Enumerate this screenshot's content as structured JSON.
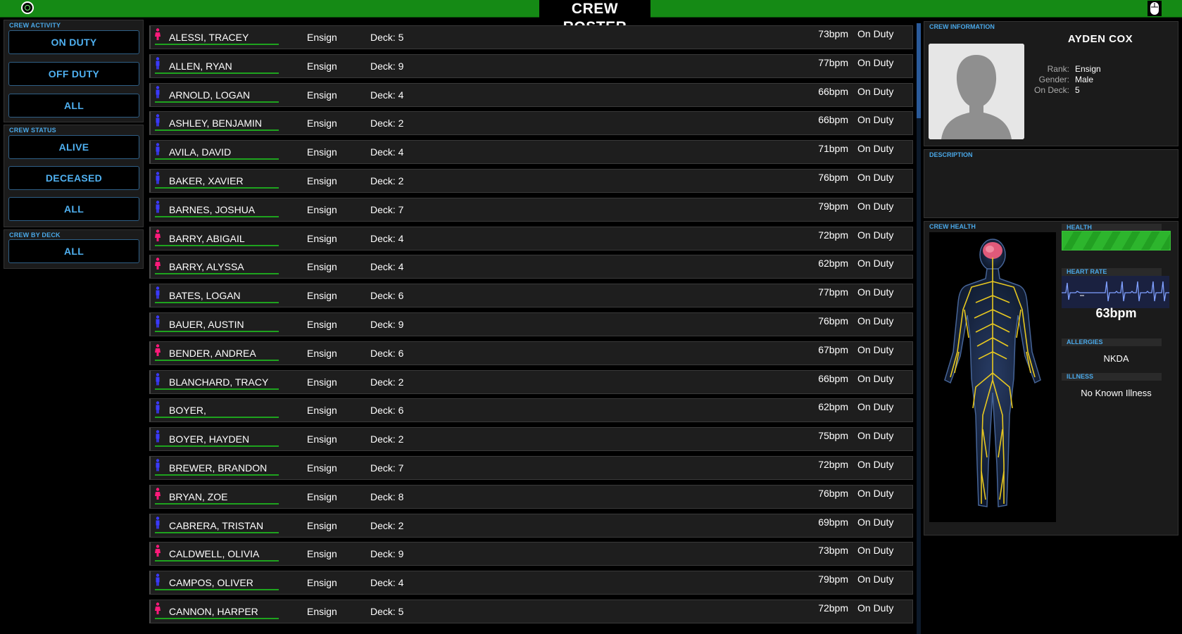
{
  "header": {
    "title": "CREW ROSTER"
  },
  "filters": {
    "activity": {
      "title": "CREW ACTIVITY",
      "buttons": [
        "ON DUTY",
        "OFF DUTY",
        "ALL"
      ]
    },
    "status": {
      "title": "CREW STATUS",
      "buttons": [
        "ALIVE",
        "DECEASED",
        "ALL"
      ]
    },
    "deck": {
      "title": "CREW BY DECK",
      "buttons": [
        "ALL"
      ]
    }
  },
  "roster": [
    {
      "name": "ALESSI, TRACEY",
      "gender": "female",
      "rank": "Ensign",
      "deck": "Deck: 5",
      "bpm": "73bpm",
      "status": "On Duty"
    },
    {
      "name": "ALLEN, RYAN",
      "gender": "male",
      "rank": "Ensign",
      "deck": "Deck: 9",
      "bpm": "77bpm",
      "status": "On Duty"
    },
    {
      "name": "ARNOLD, LOGAN",
      "gender": "male",
      "rank": "Ensign",
      "deck": "Deck: 4",
      "bpm": "66bpm",
      "status": "On Duty"
    },
    {
      "name": "ASHLEY, BENJAMIN",
      "gender": "male",
      "rank": "Ensign",
      "deck": "Deck: 2",
      "bpm": "66bpm",
      "status": "On Duty"
    },
    {
      "name": "AVILA, DAVID",
      "gender": "male",
      "rank": "Ensign",
      "deck": "Deck: 4",
      "bpm": "71bpm",
      "status": "On Duty"
    },
    {
      "name": "BAKER, XAVIER",
      "gender": "male",
      "rank": "Ensign",
      "deck": "Deck: 2",
      "bpm": "76bpm",
      "status": "On Duty"
    },
    {
      "name": "BARNES, JOSHUA",
      "gender": "male",
      "rank": "Ensign",
      "deck": "Deck: 7",
      "bpm": "79bpm",
      "status": "On Duty"
    },
    {
      "name": "BARRY, ABIGAIL",
      "gender": "female",
      "rank": "Ensign",
      "deck": "Deck: 4",
      "bpm": "72bpm",
      "status": "On Duty"
    },
    {
      "name": "BARRY, ALYSSA",
      "gender": "female",
      "rank": "Ensign",
      "deck": "Deck: 4",
      "bpm": "62bpm",
      "status": "On Duty"
    },
    {
      "name": "BATES, LOGAN",
      "gender": "male",
      "rank": "Ensign",
      "deck": "Deck: 6",
      "bpm": "77bpm",
      "status": "On Duty"
    },
    {
      "name": "BAUER, AUSTIN",
      "gender": "male",
      "rank": "Ensign",
      "deck": "Deck: 9",
      "bpm": "76bpm",
      "status": "On Duty"
    },
    {
      "name": "BENDER, ANDREA",
      "gender": "female",
      "rank": "Ensign",
      "deck": "Deck: 6",
      "bpm": "67bpm",
      "status": "On Duty"
    },
    {
      "name": "BLANCHARD, TRACY",
      "gender": "male",
      "rank": "Ensign",
      "deck": "Deck: 2",
      "bpm": "66bpm",
      "status": "On Duty"
    },
    {
      "name": "BOYER,",
      "gender": "male",
      "rank": "Ensign",
      "deck": "Deck: 6",
      "bpm": "62bpm",
      "status": "On Duty"
    },
    {
      "name": "BOYER, HAYDEN",
      "gender": "male",
      "rank": "Ensign",
      "deck": "Deck: 2",
      "bpm": "75bpm",
      "status": "On Duty"
    },
    {
      "name": "BREWER, BRANDON",
      "gender": "male",
      "rank": "Ensign",
      "deck": "Deck: 7",
      "bpm": "72bpm",
      "status": "On Duty"
    },
    {
      "name": "BRYAN, ZOE",
      "gender": "female",
      "rank": "Ensign",
      "deck": "Deck: 8",
      "bpm": "76bpm",
      "status": "On Duty"
    },
    {
      "name": "CABRERA, TRISTAN",
      "gender": "male",
      "rank": "Ensign",
      "deck": "Deck: 2",
      "bpm": "69bpm",
      "status": "On Duty"
    },
    {
      "name": "CALDWELL, OLIVIA",
      "gender": "female",
      "rank": "Ensign",
      "deck": "Deck: 9",
      "bpm": "73bpm",
      "status": "On Duty"
    },
    {
      "name": "CAMPOS, OLIVER",
      "gender": "male",
      "rank": "Ensign",
      "deck": "Deck: 4",
      "bpm": "79bpm",
      "status": "On Duty"
    },
    {
      "name": "CANNON, HARPER",
      "gender": "female",
      "rank": "Ensign",
      "deck": "Deck: 5",
      "bpm": "72bpm",
      "status": "On Duty"
    }
  ],
  "crew_info": {
    "title": "CREW INFORMATION",
    "name": "AYDEN COX",
    "rank_label": "Rank:",
    "rank": "Ensign",
    "gender_label": "Gender:",
    "gender": "Male",
    "deck_label": "On Deck:",
    "deck": "5",
    "description_title": "DESCRIPTION"
  },
  "crew_health": {
    "title": "CREW HEALTH",
    "health_label": "HEALTH",
    "health_level": 1.0,
    "heart_rate_label": "HEART RATE",
    "heart_rate": "63bpm",
    "allergies_label": "ALLERGIES",
    "allergies": "NKDA",
    "illness_label": "ILLNESS",
    "illness": "No Known Illness"
  },
  "colors": {
    "accent_green": "#158a15",
    "accent_blue": "#4fb0f0",
    "male": "#3a3aff",
    "female": "#ff1a7a"
  },
  "icons": {
    "top_left": "circle-target-icon",
    "top_right": "mouse-icon",
    "male": "male-figure-icon",
    "female": "female-figure-icon"
  }
}
